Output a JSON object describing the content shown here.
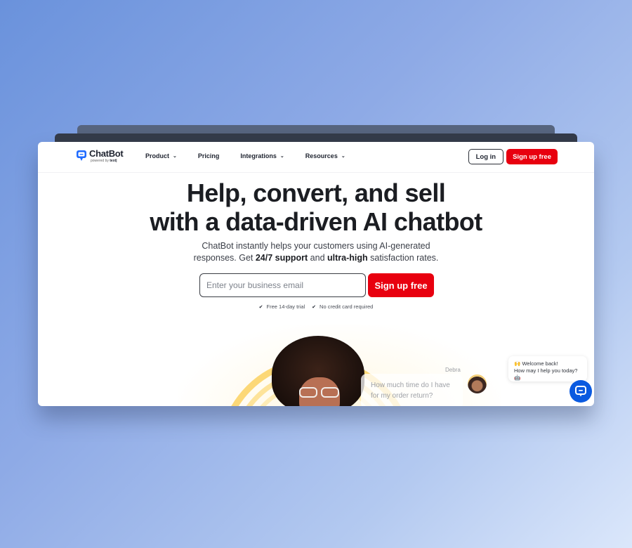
{
  "brand": {
    "name": "ChatBot",
    "powered_by": "powered by",
    "powered_by_brand": "text|",
    "accent": "#e8000f",
    "logo_color": "#1f6bff"
  },
  "nav": {
    "items": [
      {
        "label": "Product",
        "has_dropdown": true,
        "icon": "chevron-down-icon"
      },
      {
        "label": "Pricing",
        "has_dropdown": false
      },
      {
        "label": "Integrations",
        "has_dropdown": true,
        "icon": "chevron-down-icon"
      },
      {
        "label": "Resources",
        "has_dropdown": true,
        "icon": "chevron-down-icon"
      }
    ],
    "login_label": "Log in",
    "signup_label": "Sign up free",
    "chevron": "⌄"
  },
  "hero": {
    "title_line1": "Help, convert, and sell",
    "title_line2": "with a data-driven AI chatbot",
    "subtitle_part1": "ChatBot instantly helps your customers using AI-generated",
    "subtitle_part2": "responses. Get ",
    "subtitle_bold1": "24/7 support",
    "subtitle_part3": " and ",
    "subtitle_bold2": "ultra-high",
    "subtitle_part4": " satisfaction rates.",
    "email_placeholder": "Enter your business email",
    "email_value": "",
    "cta_label": "Sign up free",
    "perks": [
      {
        "icon": "check-icon",
        "glyph": "✔",
        "label": "Free 14-day trial"
      },
      {
        "icon": "check-icon",
        "glyph": "✔",
        "label": "No credit card required"
      }
    ]
  },
  "visual": {
    "chat_author": "Debra",
    "chat_message_line1": "How much time do I have",
    "chat_message_line2": "for my order return?"
  },
  "widget": {
    "greeting_emoji": "🙌",
    "greeting_line1": "Welcome back!",
    "greeting_line2": "How may I help you today?",
    "bot_emoji": "🤖",
    "button_color": "#0a5ae0"
  }
}
